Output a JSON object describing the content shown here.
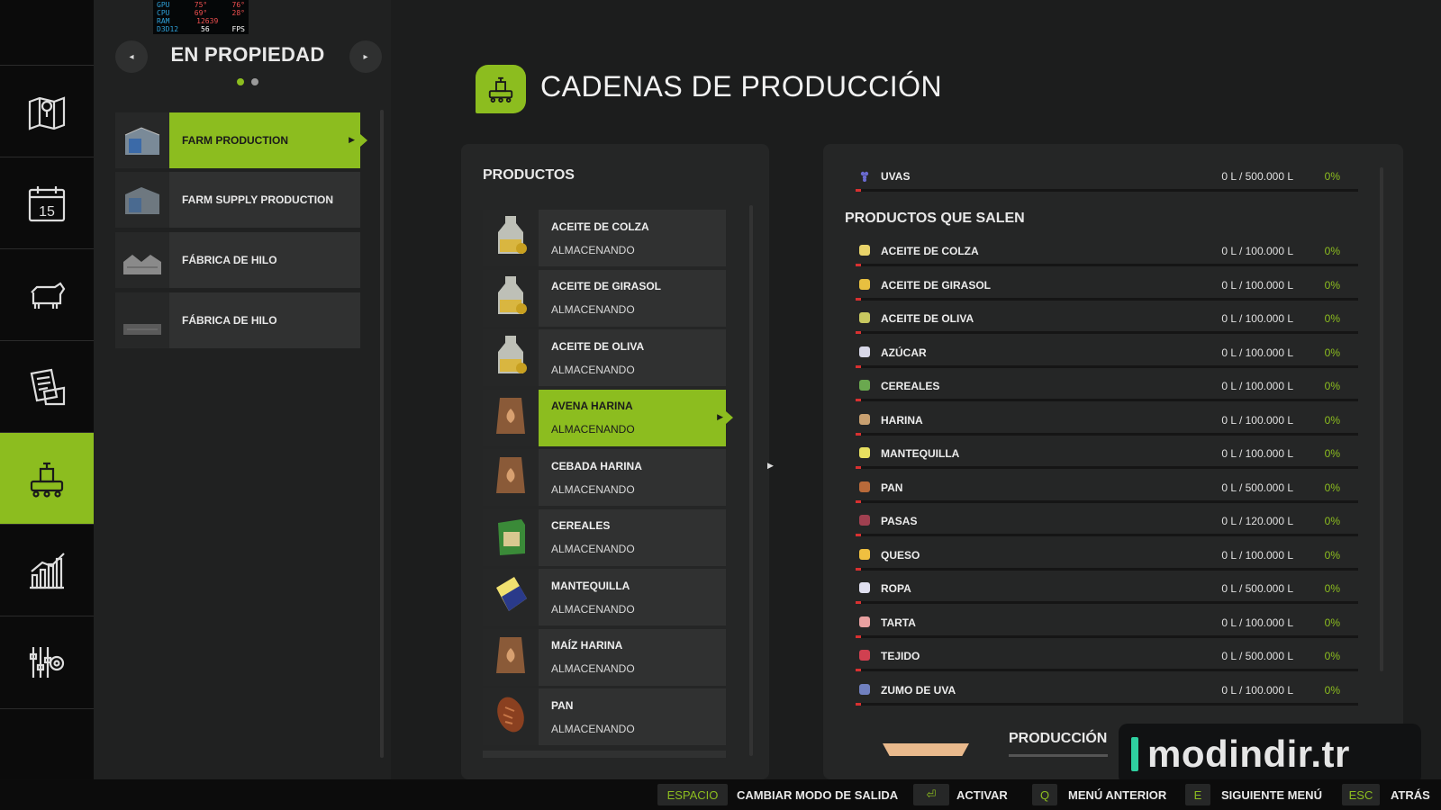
{
  "perf_overlay": [
    {
      "label": "GPU",
      "val1": "75°",
      "val2": "76°"
    },
    {
      "label": "CPU",
      "val1": "69°",
      "val2": "28°"
    },
    {
      "label": "RAM",
      "val1": "12639",
      "val2": ""
    },
    {
      "label": "D3D12",
      "val1": "56",
      "val2": "FPS"
    }
  ],
  "rail": {
    "active_index": 4,
    "icons": [
      "map-icon",
      "calendar-icon",
      "cow-icon",
      "contract-icon",
      "production-icon",
      "stats-icon",
      "settings-icon"
    ],
    "calendar_day": "15"
  },
  "owned": {
    "title": "EN PROPIEDAD",
    "prev": "◂",
    "next": "▸",
    "dots": [
      {
        "active": true
      },
      {
        "active": false
      }
    ],
    "items": [
      {
        "label": "FARM PRODUCTION",
        "active": true
      },
      {
        "label": "FARM SUPPLY PRODUCTION",
        "active": false
      },
      {
        "label": "FÁBRICA DE HILO",
        "active": false
      },
      {
        "label": "FÁBRICA DE HILO",
        "active": false
      }
    ]
  },
  "header": {
    "title": "CADENAS DE PRODUCCIÓN",
    "accent": "#8cbd1f"
  },
  "productos": {
    "title": "PRODUCTOS",
    "items": [
      {
        "name": "ACEITE DE COLZA",
        "status": "ALMACENANDO",
        "icon": "oil-bottle-icon"
      },
      {
        "name": "ACEITE DE GIRASOL",
        "status": "ALMACENANDO",
        "icon": "oil-bottle-icon"
      },
      {
        "name": "ACEITE DE OLIVA",
        "status": "ALMACENANDO",
        "icon": "oil-bottle-icon"
      },
      {
        "name": "AVENA HARINA",
        "status": "ALMACENANDO",
        "icon": "flour-sack-icon",
        "active": true
      },
      {
        "name": "CEBADA HARINA",
        "status": "ALMACENANDO",
        "icon": "flour-sack-icon"
      },
      {
        "name": "CEREALES",
        "status": "ALMACENANDO",
        "icon": "cereal-box-icon"
      },
      {
        "name": "MANTEQUILLA",
        "status": "ALMACENANDO",
        "icon": "butter-icon"
      },
      {
        "name": "MAÍZ HARINA",
        "status": "ALMACENANDO",
        "icon": "flour-sack-icon"
      },
      {
        "name": "PAN",
        "status": "ALMACENANDO",
        "icon": "bread-icon"
      }
    ]
  },
  "detail": {
    "input": {
      "name": "UVAS",
      "amount": "0 L / 500.000 L",
      "pct": "0%"
    },
    "outputs_title": "PRODUCTOS QUE SALEN",
    "outputs": [
      {
        "name": "ACEITE DE COLZA",
        "amount": "0 L / 100.000 L",
        "pct": "0%",
        "color": "#e8d36a"
      },
      {
        "name": "ACEITE DE GIRASOL",
        "amount": "0 L / 100.000 L",
        "pct": "0%",
        "color": "#e8c040"
      },
      {
        "name": "ACEITE DE OLIVA",
        "amount": "0 L / 100.000 L",
        "pct": "0%",
        "color": "#c8c860"
      },
      {
        "name": "AZÚCAR",
        "amount": "0 L / 100.000 L",
        "pct": "0%",
        "color": "#d8d8e8"
      },
      {
        "name": "CEREALES",
        "amount": "0 L / 100.000 L",
        "pct": "0%",
        "color": "#6aa84f"
      },
      {
        "name": "HARINA",
        "amount": "0 L / 100.000 L",
        "pct": "0%",
        "color": "#c8a070"
      },
      {
        "name": "MANTEQUILLA",
        "amount": "0 L / 100.000 L",
        "pct": "0%",
        "color": "#e8e060"
      },
      {
        "name": "PAN",
        "amount": "0 L / 500.000 L",
        "pct": "0%",
        "color": "#b86a3a"
      },
      {
        "name": "PASAS",
        "amount": "0 L / 120.000 L",
        "pct": "0%",
        "color": "#a04050"
      },
      {
        "name": "QUESO",
        "amount": "0 L / 100.000 L",
        "pct": "0%",
        "color": "#f0c040"
      },
      {
        "name": "ROPA",
        "amount": "0 L / 500.000 L",
        "pct": "0%",
        "color": "#e0e0f0"
      },
      {
        "name": "TARTA",
        "amount": "0 L / 100.000 L",
        "pct": "0%",
        "color": "#e8a0a0"
      },
      {
        "name": "TEJIDO",
        "amount": "0 L / 500.000 L",
        "pct": "0%",
        "color": "#d04050"
      },
      {
        "name": "ZUMO DE UVA",
        "amount": "0 L / 100.000 L",
        "pct": "0%",
        "color": "#7080c0"
      }
    ],
    "production_title": "PRODUCCIÓN"
  },
  "bottom": [
    {
      "key": "ESPACIO",
      "label": "CAMBIAR MODO DE SALIDA"
    },
    {
      "key": "⏎",
      "label": "ACTIVAR"
    },
    {
      "key": "Q",
      "label": "MENÚ ANTERIOR"
    },
    {
      "key": "E",
      "label": "SIGUIENTE MENÚ"
    },
    {
      "key": "ESC",
      "label": "ATRÁS"
    }
  ],
  "watermark": "modindir.tr"
}
